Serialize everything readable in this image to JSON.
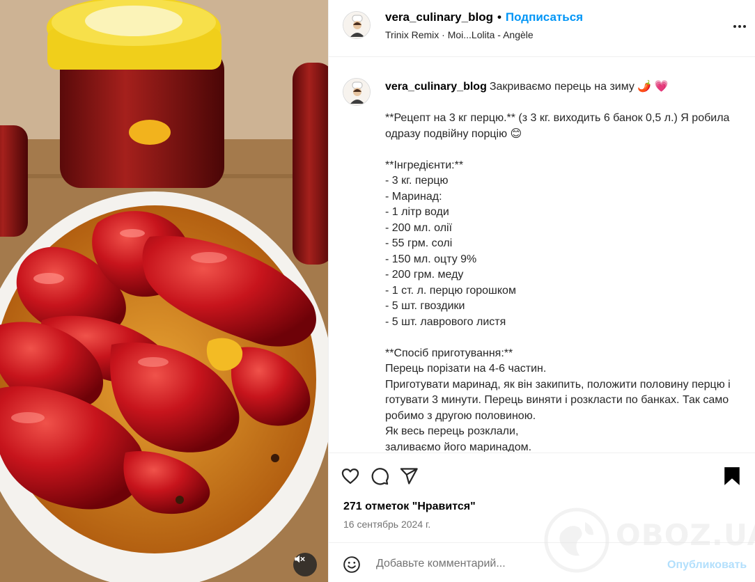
{
  "colors": {
    "accent": "#0095f6",
    "publish_disabled": "#b2dffc",
    "muted_text": "#737373",
    "divider": "#efefef"
  },
  "media": {
    "description_icon": "speaker-muted-icon"
  },
  "header": {
    "username": "vera_culinary_blog",
    "separator": "•",
    "follow_label": "Подписаться",
    "audio": "Trinix Remix · Moi...Lolita - Angèle"
  },
  "caption": {
    "username": "vera_culinary_blog",
    "title": "Закриваємо перець на зиму 🌶️ 💗",
    "lines": [
      "**Рецепт на 3 кг перцю.** (з 3 кг. виходить 6 банок 0,5 л.) Я робила одразу подвійну порцію 😊",
      "",
      "**Інгредієнти:**",
      "- 3 кг. перцю",
      "- Маринад:",
      "- 1 літр води",
      "- 200 мл. олії",
      "- 55 грм. солі",
      "- 150 мл. оцту 9%",
      "- 200 грм. меду",
      "- 1 ст. л. перцю горошком",
      "- 5 шт. гвоздики",
      "- 5 шт. лаврового листя",
      "",
      "**Спосіб приготування:**",
      "Перець порізати на 4-6 частин.",
      "Приготувати маринад, як він закипить, положити половину перцю і готувати 3 минути. Перець виняти і розкласти по банках. Так само робимо з другою половиною.",
      "Як весь перець розклали,",
      "заливаємо його маринадом."
    ]
  },
  "actions": {
    "likes": "271 отметок \"Нравится\"",
    "date": "16 сентябрь 2024 г."
  },
  "comment": {
    "placeholder": "Добавьте комментарий...",
    "publish_label": "Опубликовать"
  },
  "watermark": {
    "text": "OBOZ.UA"
  }
}
